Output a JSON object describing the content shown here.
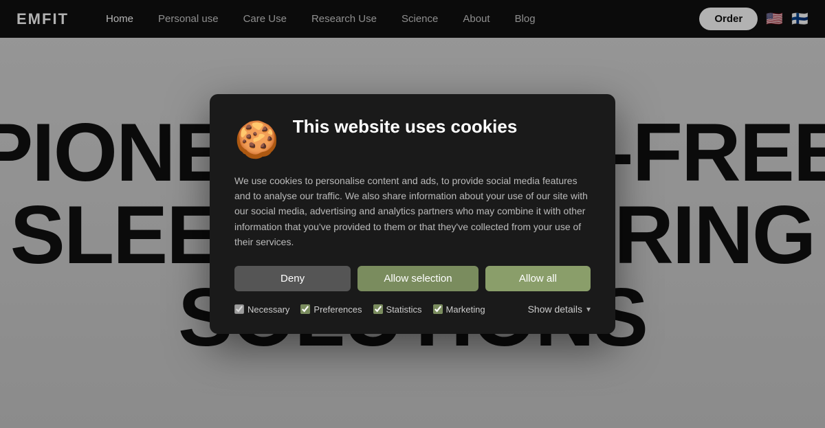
{
  "navbar": {
    "logo": "EMFIT",
    "links": [
      {
        "label": "Home",
        "active": true
      },
      {
        "label": "Personal use",
        "active": false
      },
      {
        "label": "Care Use",
        "active": false
      },
      {
        "label": "Research Use",
        "active": false
      },
      {
        "label": "Science",
        "active": false
      },
      {
        "label": "About",
        "active": false
      },
      {
        "label": "Blog",
        "active": false
      }
    ],
    "order_label": "Order",
    "flag_us": "🇺🇸",
    "flag_fi": "🇫🇮"
  },
  "hero": {
    "line1": "PIONEE",
    "line1_suffix": "T-FREE",
    "line2": "SLEEP MONITORING",
    "line3": "SOLUTIONS"
  },
  "cookie": {
    "icon": "🍪",
    "title": "This website uses cookies",
    "body": "We use cookies to personalise content and ads, to provide social media features and to analyse our traffic. We also share information about your use of our site with our social media, advertising and analytics partners who may combine it with other information that you've provided to them or that they've collected from your use of their services.",
    "btn_deny": "Deny",
    "btn_allow_selection": "Allow selection",
    "btn_allow_all": "Allow all",
    "checkboxes": [
      {
        "label": "Necessary",
        "checked": true,
        "disabled": true
      },
      {
        "label": "Preferences",
        "checked": true
      },
      {
        "label": "Statistics",
        "checked": true
      },
      {
        "label": "Marketing",
        "checked": true
      }
    ],
    "show_details": "Show details"
  }
}
